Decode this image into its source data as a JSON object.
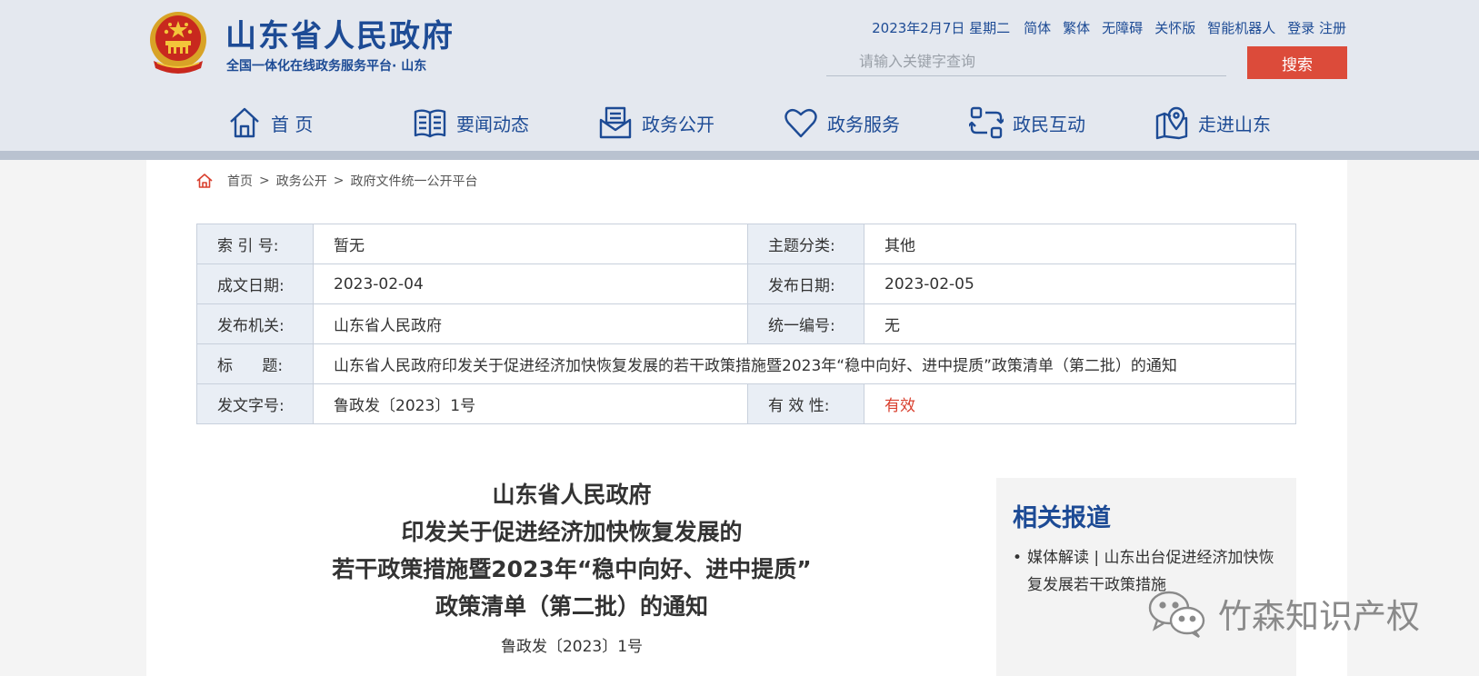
{
  "header": {
    "site_title": "山东省人民政府",
    "site_subtitle": "全国一体化在线政务服务平台· 山东",
    "date": "2023年2月7日 星期二",
    "links": [
      "简体",
      "繁体",
      "无障碍",
      "关怀版",
      "智能机器人",
      "登录 注册"
    ],
    "search_placeholder": "请输入关键字查询",
    "search_button": "搜索",
    "nav": [
      {
        "label": "首 页",
        "icon": "home-icon"
      },
      {
        "label": "要闻动态",
        "icon": "book-icon"
      },
      {
        "label": "政务公开",
        "icon": "document-icon"
      },
      {
        "label": "政务服务",
        "icon": "heart-icon"
      },
      {
        "label": "政民互动",
        "icon": "interaction-icon"
      },
      {
        "label": "走进山东",
        "icon": "map-pin-icon"
      }
    ],
    "colors": {
      "brand": "#1d4b95",
      "accent": "#dc4b3a"
    }
  },
  "breadcrumb": [
    "首页",
    "政务公开",
    "政府文件统一公开平台"
  ],
  "meta": {
    "index_no_label": "索 引 号:",
    "index_no": "暂无",
    "topic_label": "主题分类:",
    "topic": "其他",
    "written_date_label": "成文日期:",
    "written_date": "2023-02-04",
    "publish_date_label": "发布日期:",
    "publish_date": "2023-02-05",
    "issuer_label": "发布机关:",
    "issuer": "山东省人民政府",
    "serial_label": "统一编号:",
    "serial": "无",
    "title_label": "标      题:",
    "title": "山东省人民政府印发关于促进经济加快恢复发展的若干政策措施暨2023年“稳中向好、进中提质”政策清单（第二批）的通知",
    "doc_no_label": "发文字号:",
    "doc_no": "鲁政发〔2023〕1号",
    "validity_label": "有 效 性:",
    "validity": "有效"
  },
  "document": {
    "title_lines": [
      "山东省人民政府",
      "印发关于促进经济加快恢复发展的",
      "若干政策措施暨2023年“稳中向好、进中提质”",
      "政策清单（第二批）的通知"
    ],
    "doc_no": "鲁政发〔2023〕1号"
  },
  "related": {
    "title": "相关报道",
    "items": [
      "媒体解读 | 山东出台促进经济加快恢复发展若干政策措施"
    ]
  },
  "watermark": "竹森知识产权"
}
